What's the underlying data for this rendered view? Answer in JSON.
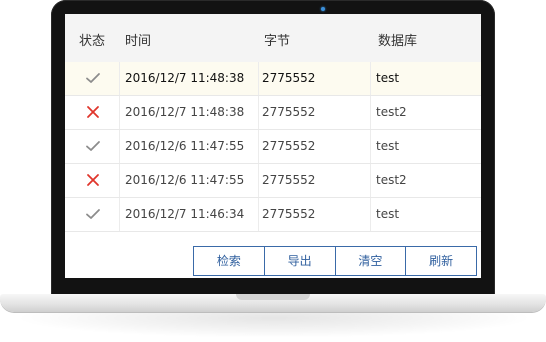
{
  "table": {
    "headers": {
      "status": "状态",
      "time": "时间",
      "bytes": "字节",
      "database": "数据库"
    },
    "rows": [
      {
        "status": "success",
        "status_icon": "check-icon",
        "time": "2016/12/7 11:48:38",
        "bytes": "2775552",
        "database": "test",
        "selected": true
      },
      {
        "status": "failure",
        "status_icon": "cross-icon",
        "time": "2016/12/7 11:48:38",
        "bytes": "2775552",
        "database": "test2",
        "selected": false
      },
      {
        "status": "success",
        "status_icon": "check-icon",
        "time": "2016/12/6 11:47:55",
        "bytes": "2775552",
        "database": "test",
        "selected": false
      },
      {
        "status": "failure",
        "status_icon": "cross-icon",
        "time": "2016/12/6 11:47:55",
        "bytes": "2775552",
        "database": "test2",
        "selected": false
      },
      {
        "status": "success",
        "status_icon": "check-icon",
        "time": "2016/12/7 11:46:34",
        "bytes": "2775552",
        "database": "test",
        "selected": false
      }
    ]
  },
  "toolbar": {
    "search_label": "检索",
    "export_label": "导出",
    "clear_label": "清空",
    "refresh_label": "刷新"
  },
  "colors": {
    "check": "#8c8c8c",
    "cross": "#e0352b",
    "button_border": "#3a6aa8",
    "button_text": "#2f5f9e",
    "selected_row": "#fdfbf0"
  }
}
